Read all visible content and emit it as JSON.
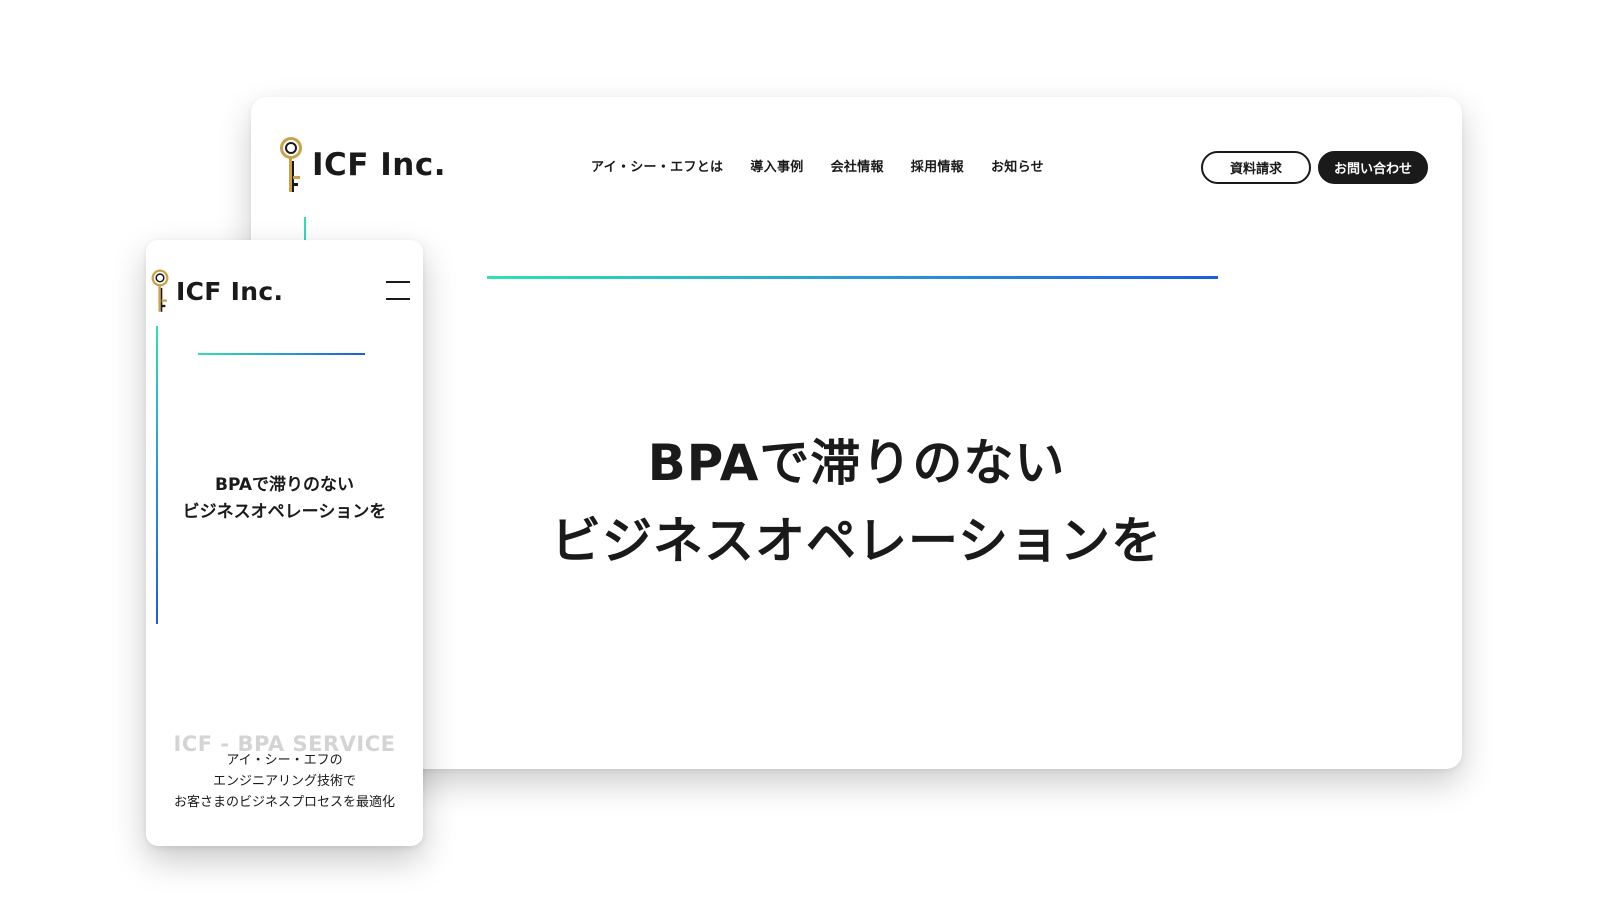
{
  "brand": {
    "name": "ICF Inc.",
    "logo_icon": "key-icon",
    "logo_colors": {
      "gold": "#c9a24a",
      "dark": "#1a1a1a"
    }
  },
  "desktop": {
    "nav": [
      {
        "label": "アイ・シー・エフとは"
      },
      {
        "label": "導入事例"
      },
      {
        "label": "会社情報"
      },
      {
        "label": "採用情報"
      },
      {
        "label": "お知らせ"
      }
    ],
    "buttons": {
      "request_docs": "資料請求",
      "contact": "お問い合わせ"
    },
    "headline": {
      "line1": "BPAで滞りのない",
      "line2": "ビジネスオペレーションを"
    }
  },
  "mobile": {
    "menu_icon": "hamburger-menu-icon",
    "headline": {
      "line1": "BPAで滞りのない",
      "line2": "ビジネスオペレーションを"
    },
    "watermark": "ICF - BPA SERVICE",
    "subtext": {
      "line1": "アイ・シー・エフの",
      "line2": "エンジニアリング技術で",
      "line3": "お客さまのビジネスプロセスを最適化"
    }
  },
  "colors": {
    "accent_start": "#2ee3b0",
    "accent_end": "#1f5be0",
    "text": "#1a1a1a",
    "background": "#ffffff"
  }
}
